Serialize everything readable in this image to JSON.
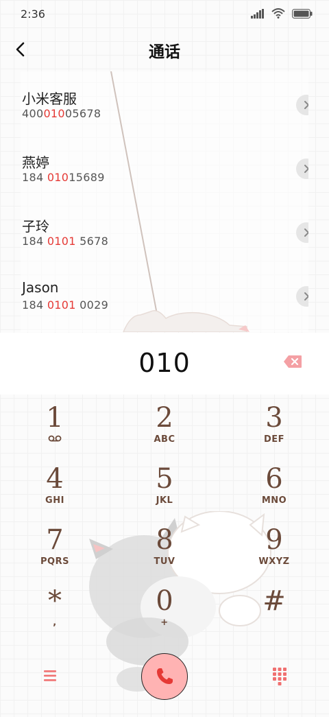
{
  "status": {
    "time": "2:36"
  },
  "header": {
    "title": "通话"
  },
  "contacts": [
    {
      "name": "小米客服",
      "number_parts": [
        "400",
        "010",
        "05678"
      ]
    },
    {
      "name": "燕婷",
      "number_parts": [
        "184 ",
        "010",
        "15689"
      ]
    },
    {
      "name": "子玲",
      "number_parts": [
        "184 ",
        "0101",
        " 5678"
      ]
    },
    {
      "name": "Jason",
      "number_parts": [
        "184 ",
        "0101",
        " 0029"
      ]
    }
  ],
  "dialer": {
    "digits": "010"
  },
  "keypad": [
    {
      "digit": "1",
      "sub": "voicemail-icon"
    },
    {
      "digit": "2",
      "sub": "ABC"
    },
    {
      "digit": "3",
      "sub": "DEF"
    },
    {
      "digit": "4",
      "sub": "GHI"
    },
    {
      "digit": "5",
      "sub": "JKL"
    },
    {
      "digit": "6",
      "sub": "MNO"
    },
    {
      "digit": "7",
      "sub": "PQRS"
    },
    {
      "digit": "8",
      "sub": "TUV"
    },
    {
      "digit": "9",
      "sub": "WXYZ"
    },
    {
      "digit": "*",
      "sub": ","
    },
    {
      "digit": "0",
      "sub": "+"
    },
    {
      "digit": "#",
      "sub": ""
    }
  ],
  "colors": {
    "accent": "#e53935",
    "call_button": "#ffb3b3",
    "key_text": "#6b4a3a",
    "menu_icon": "#f07070"
  },
  "icons": {
    "back": "chevron-left-icon",
    "signal": "signal-icon",
    "wifi": "wifi-icon",
    "battery": "battery-icon",
    "row_action": "chevron-right-icon",
    "backspace": "backspace-icon",
    "menu": "menu-icon",
    "call": "phone-icon",
    "keypad_toggle": "dialpad-icon"
  }
}
